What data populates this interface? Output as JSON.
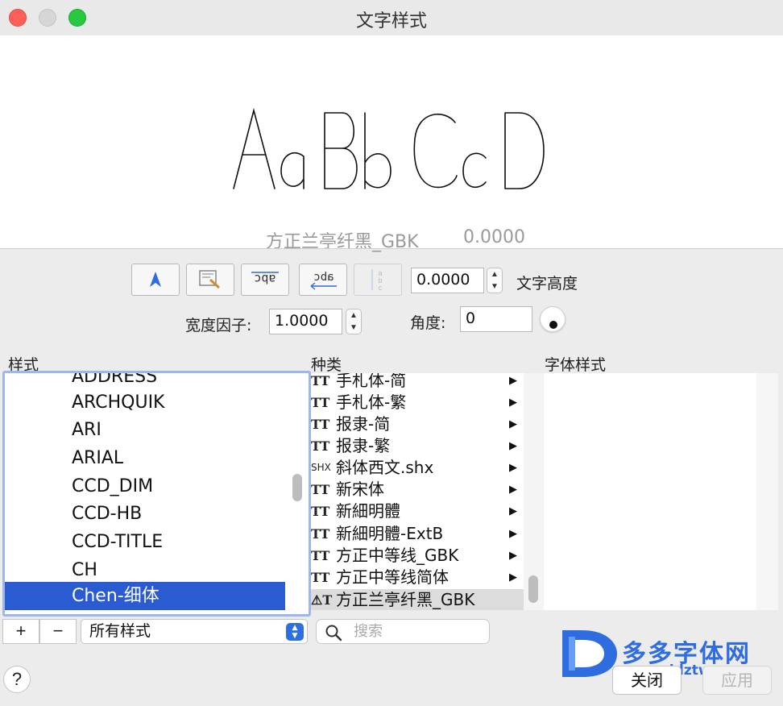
{
  "window": {
    "title": "文字样式"
  },
  "preview": {
    "sample_text": "AaBbCcD",
    "font_name": "方正兰亭纤黑_GBK",
    "size": "0.0000"
  },
  "toolbar": {
    "annotative_icon": "annotative-icon",
    "height_value": "0.0000",
    "height_label": "文字高度",
    "width_factor_label": "宽度因子:",
    "width_factor_value": "1.0000",
    "angle_label": "角度:",
    "angle_value": "0"
  },
  "columns": {
    "styles": "样式",
    "category": "种类",
    "font_style": "字体样式"
  },
  "styles": {
    "items": [
      {
        "label": "ADDRESS"
      },
      {
        "label": "ARCHQUIK"
      },
      {
        "label": "ARI"
      },
      {
        "label": "ARIAL"
      },
      {
        "label": "CCD_DIM"
      },
      {
        "label": "CCD-HB"
      },
      {
        "label": "CCD-TITLE"
      },
      {
        "label": "CH"
      },
      {
        "label": "Chen-细体"
      }
    ],
    "selected_index": 8
  },
  "fonts": {
    "items": [
      {
        "icon": "TT",
        "label": "手札体-简"
      },
      {
        "icon": "TT",
        "label": "手札体-繁"
      },
      {
        "icon": "TT",
        "label": "报隶-简"
      },
      {
        "icon": "TT",
        "label": "报隶-繁"
      },
      {
        "icon": "SHX",
        "label": "斜体西文.shx"
      },
      {
        "icon": "TT",
        "label": "新宋体"
      },
      {
        "icon": "TT",
        "label": "新細明體"
      },
      {
        "icon": "TT",
        "label": "新細明體-ExtB"
      },
      {
        "icon": "TT",
        "label": "方正中等线_GBK"
      },
      {
        "icon": "TT",
        "label": "方正中等线简体"
      },
      {
        "icon": "⚠T",
        "label": "方正兰亭纤黑_GBK"
      }
    ],
    "selected_index": 10
  },
  "bottom": {
    "add_label": "+",
    "remove_label": "−",
    "filter_value": "所有样式",
    "search_placeholder": "搜索",
    "help_label": "?",
    "close_label": "关闭",
    "apply_label": "应用"
  },
  "watermark": {
    "name": "多多字体网",
    "url": "www.ddztw.com"
  },
  "colors": {
    "selection": "#2a5bd1",
    "list_focus_ring": "#9db7ea",
    "brand": "#2f6ce0"
  }
}
